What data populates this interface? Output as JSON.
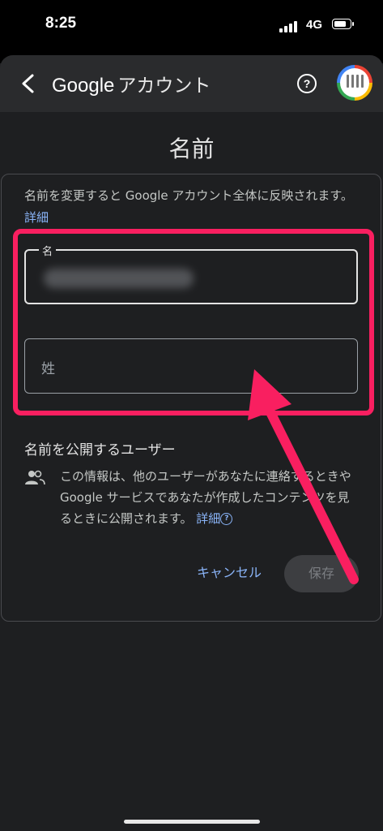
{
  "status_bar": {
    "time": "8:25",
    "network": "4G"
  },
  "header": {
    "brand": "Google",
    "brand_suffix": "アカウント"
  },
  "page": {
    "title": "名前"
  },
  "description": {
    "text": "名前を変更すると Google アカウント全体に反映されます。",
    "link": "詳細"
  },
  "fields": {
    "first_name": {
      "label": "名",
      "value": ""
    },
    "last_name": {
      "placeholder": "姓"
    }
  },
  "visibility": {
    "title": "名前を公開するユーザー",
    "text": "この情報は、他のユーザーがあなたに連絡するときや Google サービスであなたが作成したコンテンツを見るときに公開されます。",
    "link": "詳細",
    "help_glyph": "?"
  },
  "actions": {
    "cancel": "キャンセル",
    "save": "保存"
  },
  "colors": {
    "highlight": "#f91f60",
    "link": "#8ab4f8"
  },
  "icons": [
    "back-arrow-icon",
    "help-circle-icon",
    "avatar",
    "people-icon",
    "question-icon"
  ]
}
